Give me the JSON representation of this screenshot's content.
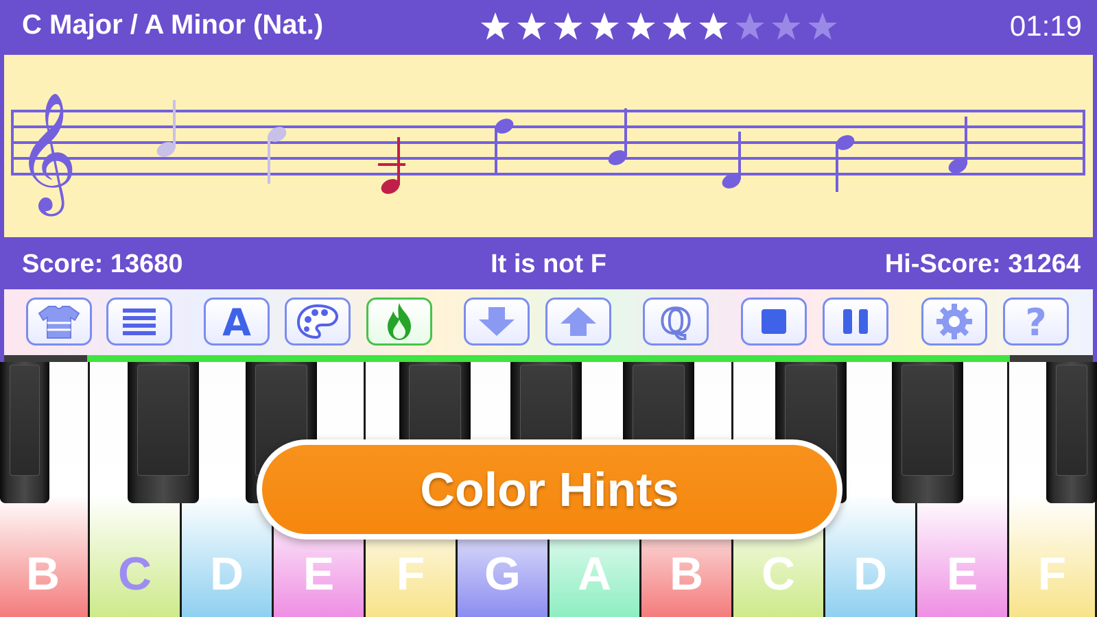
{
  "header": {
    "key_name": "C Major  /  A Minor (Nat.)",
    "stars_filled": 7,
    "stars_total": 10,
    "timer": "01:19",
    "colors": {
      "bar": "#6a4fcf",
      "star_on": "#ffffff",
      "star_off": "#9a89e6"
    }
  },
  "staff": {
    "clef": "treble",
    "notes": [
      "faded",
      "faded",
      "wrong",
      "pending",
      "pending",
      "pending",
      "pending",
      "pending"
    ],
    "colors": {
      "line": "#7460dd",
      "wrong": "#c01f4a",
      "faded": "#c9c0e8",
      "pending": "#7460dd",
      "bg": "#fdf1b8"
    }
  },
  "status": {
    "score": "Score: 13680",
    "message": "It is not F",
    "hiscore": "Hi-Score: 31264"
  },
  "toolbar": {
    "buttons": [
      "shirt-icon",
      "menu-lines-icon",
      "letter-a-icon",
      "palette-icon",
      "fire-icon",
      "arrow-down-icon",
      "arrow-up-icon",
      "quiz-q-icon",
      "stop-icon",
      "pause-icon",
      "gear-icon",
      "help-icon"
    ],
    "progress": 0.85
  },
  "keyboard": {
    "white_keys": [
      {
        "letter": "B",
        "color": "#f47c7c"
      },
      {
        "letter": "C",
        "color": "#cdea8a"
      },
      {
        "letter": "D",
        "color": "#8fd0f0"
      },
      {
        "letter": "E",
        "color": "#ee8fe3"
      },
      {
        "letter": "F",
        "color": "#f8e38a"
      },
      {
        "letter": "G",
        "color": "#8c8df0"
      },
      {
        "letter": "A",
        "color": "#8eeec2"
      },
      {
        "letter": "B",
        "color": "#f47c7c"
      },
      {
        "letter": "C",
        "color": "#cdea8a"
      },
      {
        "letter": "D",
        "color": "#8fd0f0"
      },
      {
        "letter": "E",
        "color": "#ee8fe3"
      },
      {
        "letter": "F",
        "color": "#f8e38a"
      }
    ]
  },
  "overlay": {
    "hint": "Color Hints"
  }
}
